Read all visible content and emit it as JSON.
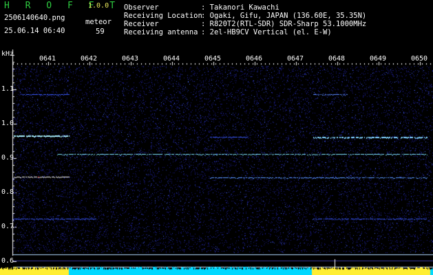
{
  "header": {
    "app_title": "H R O F F T",
    "app_version": "1.0.0",
    "filename": "2506140640.png",
    "datetime": "25.06.14 06:40",
    "meteor_label": "meteor",
    "meteor_count": "59"
  },
  "info": [
    {
      "label": "Observer",
      "value": ": Takanori Kawachi"
    },
    {
      "label": "Receiving Location",
      "value": ": Ogaki, Gifu, JAPAN (136.60E, 35.35N)"
    },
    {
      "label": "Receiver",
      "value": ": R820T2(RTL-SDR) SDR-Sharp 53.1000MHz"
    },
    {
      "label": "Receiving antenna",
      "value": ": 2el-HB9CV Vertical (el. E-W)"
    }
  ],
  "axis": {
    "y_unit": "kHz",
    "y_ticks": [
      "1.1",
      "1.0",
      "0.9",
      "0.8",
      "0.7",
      "0.6"
    ],
    "x_ticks": [
      "0641",
      "0642",
      "0643",
      "0644",
      "0645",
      "0646",
      "0647",
      "0648",
      "0649",
      "0650"
    ]
  },
  "colors": {
    "background": "#000000",
    "noise": "#1a1a80",
    "line": "#7fe6ff",
    "title": "#2ecc40",
    "version": "#e8e85a",
    "bars": "#00d8ff",
    "bars_peak": "#ffee33"
  }
}
